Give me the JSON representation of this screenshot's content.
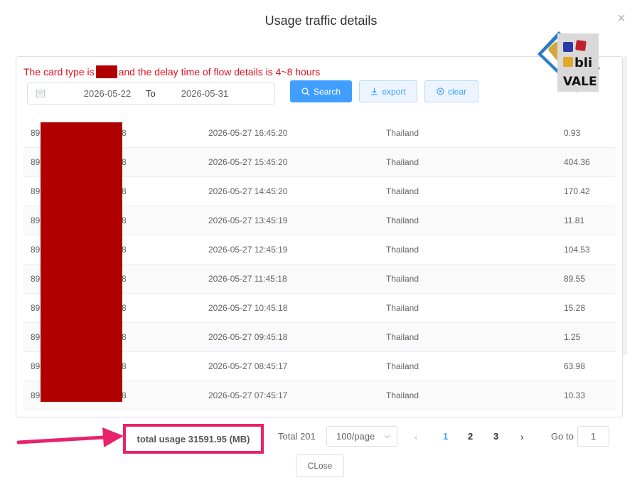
{
  "modal": {
    "title": "Usage traffic details",
    "close_icon": "close-icon"
  },
  "notice": {
    "prefix": "The card type is",
    "suffix": "and the delay time of flow details is 4~8 hours"
  },
  "filters": {
    "start_date": "2026-05-22",
    "separator": "To",
    "end_date": "2026-05-31"
  },
  "buttons": {
    "search": "Search",
    "export": "export",
    "clear": "clear",
    "close": "CLose"
  },
  "logo": {
    "text_top": "bli",
    "text_bottom": "VALE"
  },
  "table": {
    "id_prefix": "89",
    "id_suffix": "8",
    "rows": [
      {
        "time": "2026-05-27 16:45:20",
        "country": "Thailand",
        "usage": "0.93"
      },
      {
        "time": "2026-05-27 15:45:20",
        "country": "Thailand",
        "usage": "404.36"
      },
      {
        "time": "2026-05-27 14:45:20",
        "country": "Thailand",
        "usage": "170.42"
      },
      {
        "time": "2026-05-27 13:45:19",
        "country": "Thailand",
        "usage": "11.81"
      },
      {
        "time": "2026-05-27 12:45:19",
        "country": "Thailand",
        "usage": "104.53"
      },
      {
        "time": "2026-05-27 11:45:18",
        "country": "Thailand",
        "usage": "89.55"
      },
      {
        "time": "2026-05-27 10:45:18",
        "country": "Thailand",
        "usage": "15.28"
      },
      {
        "time": "2026-05-27 09:45:18",
        "country": "Thailand",
        "usage": "1.25"
      },
      {
        "time": "2026-05-27 08:45:17",
        "country": "Thailand",
        "usage": "63.98"
      },
      {
        "time": "2026-05-27 07:45:17",
        "country": "Thailand",
        "usage": "10.33"
      }
    ]
  },
  "summary": {
    "total_usage": "total usage 31591.95 (MB)"
  },
  "pagination": {
    "total": "Total 201",
    "page_size": "100/page",
    "pages": [
      "1",
      "2",
      "3"
    ],
    "current": "1",
    "goto_label": "Go to",
    "goto_value": "1"
  },
  "colors": {
    "accent": "#409eff",
    "notice": "#e3111e",
    "highlight": "#e8226b",
    "redaction": "#b00000"
  }
}
